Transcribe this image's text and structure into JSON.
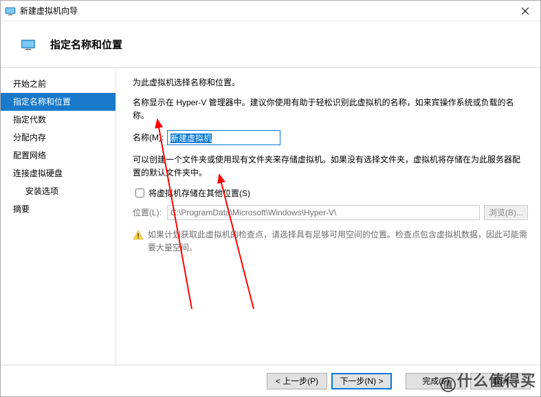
{
  "titlebar": {
    "title": "新建虚拟机向导"
  },
  "header": {
    "title": "指定名称和位置"
  },
  "sidebar": {
    "items": [
      {
        "label": "开始之前",
        "selected": false,
        "indent": false
      },
      {
        "label": "指定名称和位置",
        "selected": true,
        "indent": false
      },
      {
        "label": "指定代数",
        "selected": false,
        "indent": false
      },
      {
        "label": "分配内存",
        "selected": false,
        "indent": false
      },
      {
        "label": "配置网络",
        "selected": false,
        "indent": false
      },
      {
        "label": "连接虚拟硬盘",
        "selected": false,
        "indent": false
      },
      {
        "label": "安装选项",
        "selected": false,
        "indent": true
      },
      {
        "label": "摘要",
        "selected": false,
        "indent": false
      }
    ]
  },
  "main": {
    "intro1": "为此虚拟机选择名称和位置。",
    "intro2": "名称显示在 Hyper-V 管理器中。建议你使用有助于轻松识别此虚拟机的名称，如来宾操作系统或负载的名称。",
    "name_label": "名称(M):",
    "name_value": "新建虚拟机",
    "intro3": "可以创建一个文件夹或使用现有文件夹来存储虚拟机。如果没有选择文件夹，虚拟机将存储在为此服务器配置的默认文件夹中。",
    "store_checkbox_label": "将虚拟机存储在其他位置(S)",
    "location_label": "位置(L):",
    "location_value": "C:\\ProgramData\\Microsoft\\Windows\\Hyper-V\\",
    "browse_label": "浏览(B)...",
    "warn_text": "如果计划获取此虚拟机的检查点，请选择具有足够可用空间的位置。检查点包含虚拟机数据，因此可能需要大量空间。"
  },
  "footer": {
    "prev": "< 上一步(P)",
    "next": "下一步(N) >",
    "finish": "完成(F)",
    "cancel": "取消"
  },
  "watermark": "什么值得买"
}
